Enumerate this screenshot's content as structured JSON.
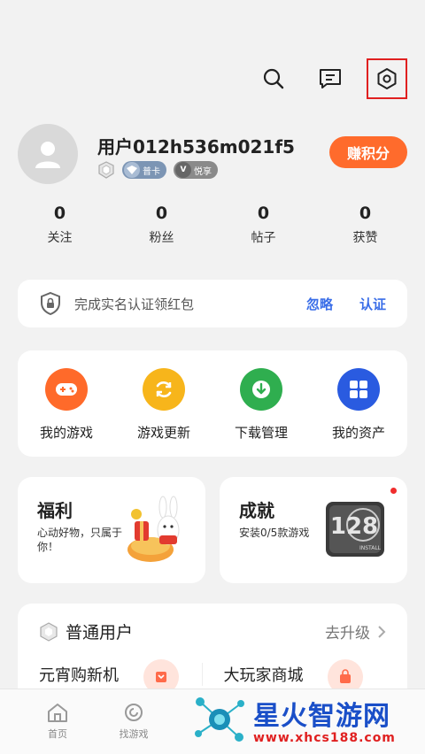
{
  "topbar": {
    "icons": [
      "search-icon",
      "message-icon",
      "settings-icon"
    ]
  },
  "profile": {
    "username": "用户012h536m021f5",
    "badges": [
      {
        "icon": "level-shield-icon",
        "label": ""
      },
      {
        "icon": "vip-card-icon",
        "label": "普卡"
      },
      {
        "icon": "v-icon",
        "label": "悦享"
      }
    ],
    "earn_label": "赚积分"
  },
  "stats": [
    {
      "value": "0",
      "label": "关注"
    },
    {
      "value": "0",
      "label": "粉丝"
    },
    {
      "value": "0",
      "label": "帖子"
    },
    {
      "value": "0",
      "label": "获赞"
    }
  ],
  "verify": {
    "text": "完成实名认证领红包",
    "ignore": "忽略",
    "confirm": "认证"
  },
  "quick": [
    {
      "label": "我的游戏",
      "color": "#ff6a2a",
      "icon": "gamepad-icon"
    },
    {
      "label": "游戏更新",
      "color": "#f7b51b",
      "icon": "refresh-icon"
    },
    {
      "label": "下载管理",
      "color": "#2fae4f",
      "icon": "download-icon"
    },
    {
      "label": "我的资产",
      "color": "#2a5be0",
      "icon": "grid-icon"
    }
  ],
  "cards": {
    "welfare": {
      "title": "福利",
      "sub": "心动好物，只属于你！"
    },
    "achievement": {
      "title": "成就",
      "sub": "安装0/5款游戏",
      "art_number": "128",
      "art_caption": "INSTALL"
    }
  },
  "member": {
    "title": "普通用户",
    "upgrade": "去升级",
    "items": [
      "元宵购新机",
      "大玩家商城"
    ]
  },
  "tabbar": [
    {
      "label": "首页",
      "icon": "home-icon"
    },
    {
      "label": "找游戏",
      "icon": "discover-icon"
    }
  ],
  "watermark": {
    "main": "星火智游网",
    "url": "www.xhcs188.com"
  }
}
